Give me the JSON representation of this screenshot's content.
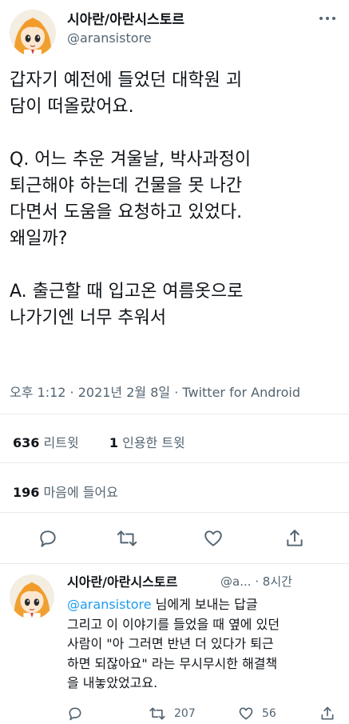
{
  "tweet": {
    "display_name": "시아란/아란시스토르",
    "handle": "@aransistore",
    "text": "갑자기 예전에 들었던 대학원 괴\n담이 떠올랐어요.\n\nQ. 어느 추운 겨울날, 박사과정이\n퇴근해야 하는데 건물을 못 나간\n다면서 도움을 요청하고 있었다.\n왜일까?\n\nA. 출근할 때 입고온 여름옷으로\n나가기엔 너무 추워서",
    "timestamp": "오후 1:12 · 2021년 2월 8일 · Twitter for Android",
    "retweets_count": "636",
    "retweets_label": "리트윗",
    "quotes_count": "1",
    "quotes_label": "인용한 트윗",
    "likes_count": "196",
    "likes_label": "마음에 들어요"
  },
  "reply": {
    "display_name": "시아란/아란시스토르",
    "handle_time": "@a... · 8시간",
    "mention": "@aransistore",
    "mention_suffix": " 님에게 보내는 답글",
    "text": "그리고 이 이야기를 들었을 때 옆에 있던\n사람이 \"아 그러면 반년 더 있다가 퇴근\n하면 되잖아요\" 라는 무시무시한 해결책\n을 내놓았었고요.",
    "retweet_count": "207",
    "like_count": "56"
  },
  "icons": {
    "more": "more-icon",
    "reply": "reply-icon",
    "retweet": "retweet-icon",
    "like": "heart-icon",
    "share": "share-icon"
  },
  "colors": {
    "text": "#0f1419",
    "secondary": "#536471",
    "link": "#1d9bf0",
    "divider": "#e6e9eb"
  }
}
